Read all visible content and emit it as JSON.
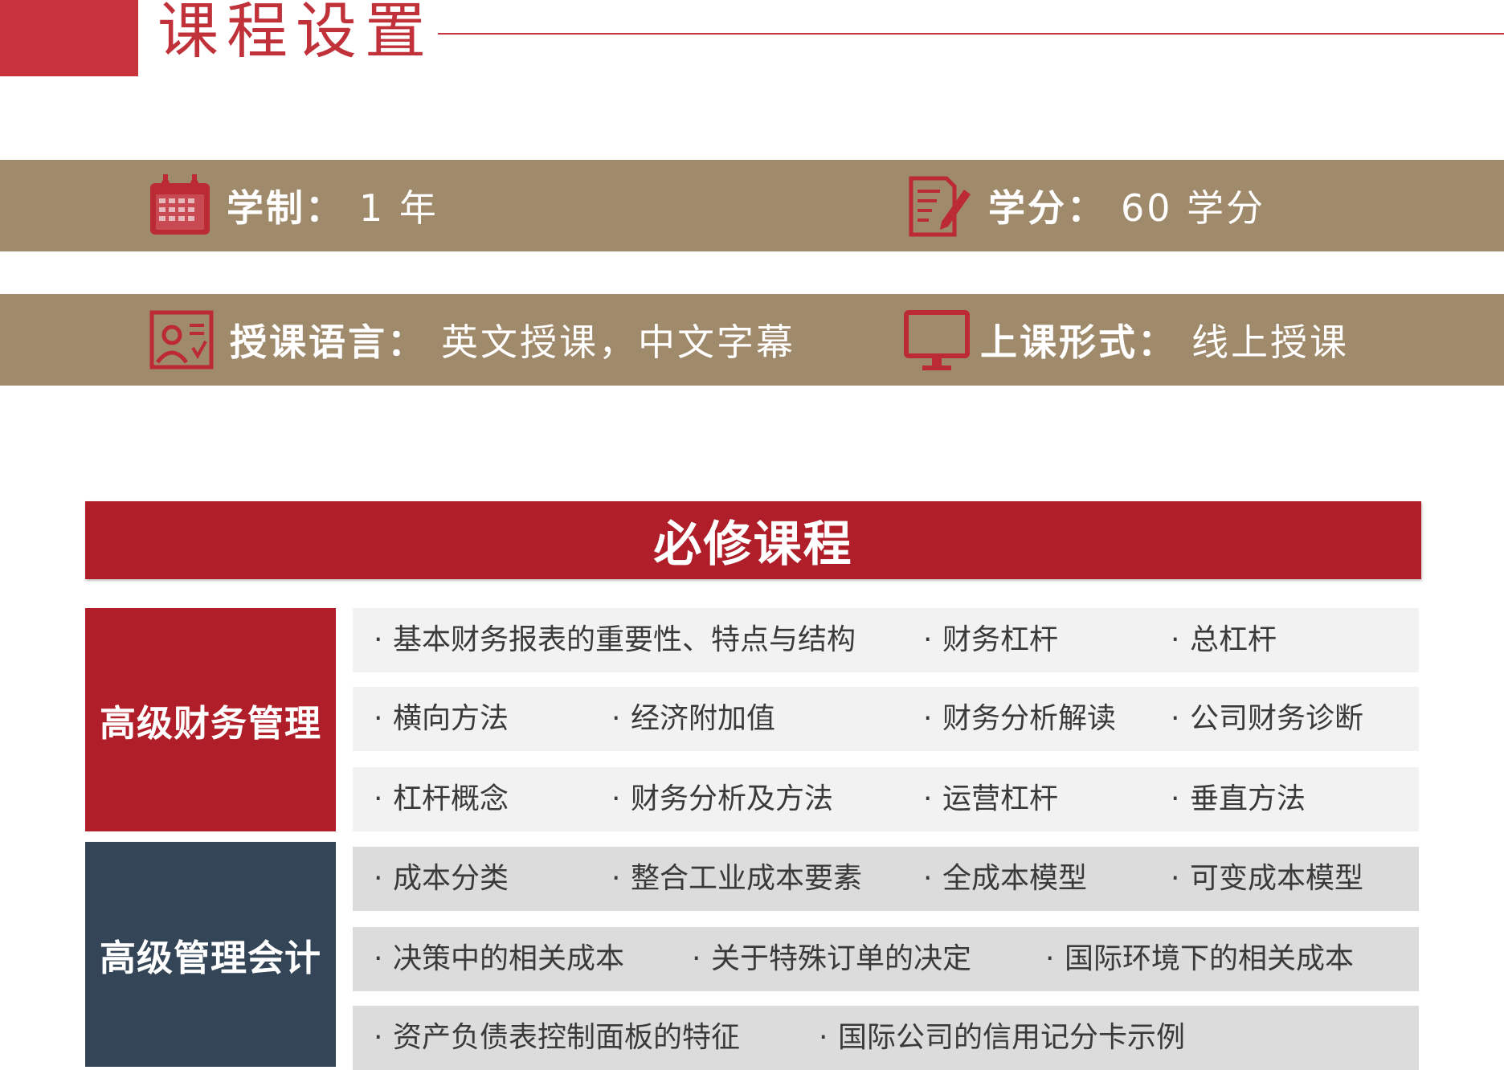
{
  "header": {
    "title": "课程设置"
  },
  "info": {
    "duration": {
      "icon": "calendar-icon",
      "label": "学制",
      "sep": "：",
      "value": "1 年"
    },
    "credits": {
      "icon": "edit-document-icon",
      "label": "学分",
      "sep": "：",
      "value": "60 学分"
    },
    "language": {
      "icon": "user-profile-card-icon",
      "label": "授课语言",
      "sep": "：",
      "value": "英文授课，中文字幕"
    },
    "format": {
      "icon": "monitor-icon",
      "label": "上课形式",
      "sep": "：",
      "value": "线上授课"
    }
  },
  "required": {
    "title": "必修课程",
    "bullet": "·",
    "finance": {
      "name": "高级财务管理",
      "rows": [
        [
          "基本财务报表的重要性、特点与结构",
          "财务杠杆",
          "总杠杆"
        ],
        [
          "横向方法",
          "经济附加值",
          "财务分析解读",
          "公司财务诊断"
        ],
        [
          "杠杆概念",
          "财务分析及方法",
          "运营杠杆",
          "垂直方法"
        ]
      ]
    },
    "accounting": {
      "name": "高级管理会计",
      "rows": [
        [
          "成本分类",
          "整合工业成本要素",
          "全成本模型",
          "可变成本模型"
        ],
        [
          "决策中的相关成本",
          "关于特殊订单的决定",
          "国际环境下的相关成本"
        ],
        [
          "资产负债表控制面板的特征",
          "国际公司的信用记分卡示例"
        ]
      ]
    }
  },
  "colors": {
    "accent_red": "#c8343d",
    "banner_red": "#b01f29",
    "band_tan": "#a08a6c",
    "navy": "#344557"
  }
}
